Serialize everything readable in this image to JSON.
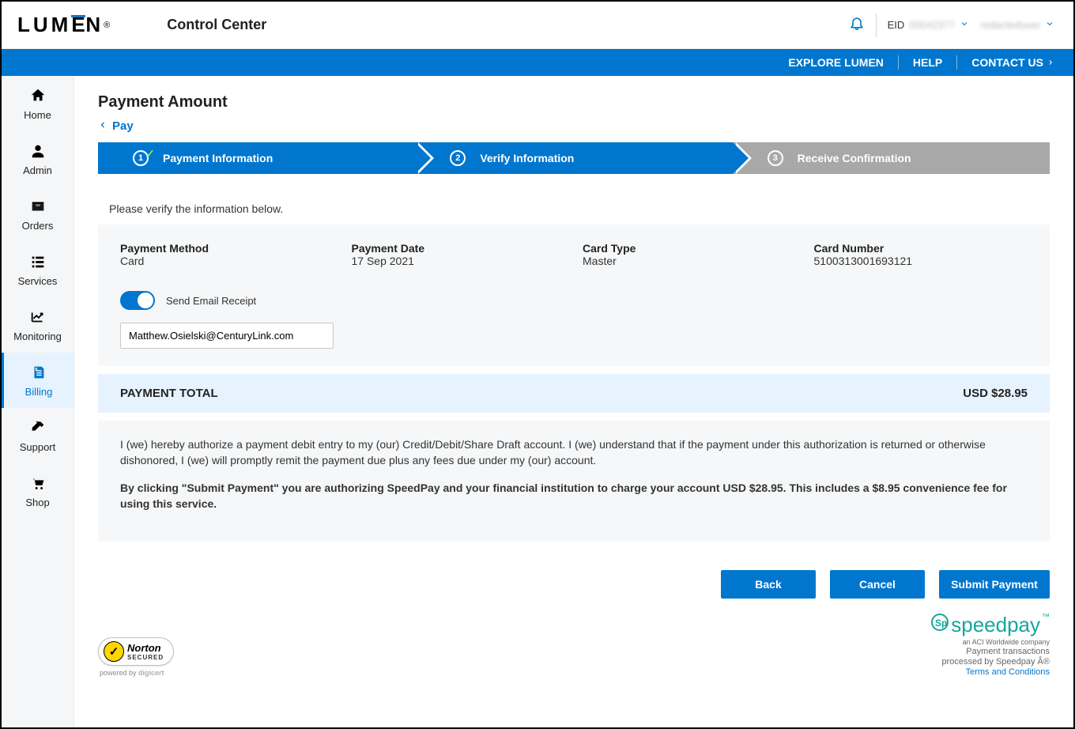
{
  "header": {
    "logo": "LUMEN",
    "app_title": "Control Center",
    "eid_label": "EID",
    "eid_value": "00042377",
    "user_name": "redacteduser"
  },
  "bluebar": {
    "explore": "EXPLORE LUMEN",
    "help": "HELP",
    "contact": "CONTACT US"
  },
  "sidebar": {
    "items": [
      {
        "label": "Home"
      },
      {
        "label": "Admin"
      },
      {
        "label": "Orders"
      },
      {
        "label": "Services"
      },
      {
        "label": "Monitoring"
      },
      {
        "label": "Billing"
      },
      {
        "label": "Support"
      },
      {
        "label": "Shop"
      }
    ]
  },
  "page": {
    "title": "Payment Amount",
    "breadcrumb": "Pay"
  },
  "steps": {
    "s1": "Payment Information",
    "s2": "Verify Information",
    "s3": "Receive Confirmation"
  },
  "verify": {
    "prompt": "Please verify the information below.",
    "pm_label": "Payment Method",
    "pm_value": "Card",
    "pd_label": "Payment Date",
    "pd_value": "17 Sep 2021",
    "ct_label": "Card Type",
    "ct_value": "Master",
    "cn_label": "Card Number",
    "cn_value": "5100313001693121",
    "toggle_label": "Send Email Receipt",
    "email": "Matthew.Osielski@CenturyLink.com"
  },
  "total": {
    "label": "PAYMENT TOTAL",
    "amount": "USD $28.95"
  },
  "auth": {
    "p1": "I (we) hereby authorize a payment debit entry to my (our) Credit/Debit/Share Draft account. I (we) understand that if the payment under this authorization is returned or otherwise dishonored, I (we) will promptly remit the payment due plus any fees due under my (our) account.",
    "p2": "By clicking \"Submit Payment\" you are authorizing SpeedPay and your financial institution to charge your account USD $28.95. This includes a $8.95 convenience fee for using this service."
  },
  "buttons": {
    "back": "Back",
    "cancel": "Cancel",
    "submit": "Submit Payment"
  },
  "footer": {
    "norton_name": "Norton",
    "norton_secured": "SECURED",
    "norton_powered": "powered by ",
    "norton_digicert": "digicert",
    "speedpay_brand": "speedpay",
    "speedpay_sub": "an ACI Worldwide company",
    "line1": "Payment transactions",
    "line2": "processed by Speedpay Â®",
    "terms": "Terms and Conditions"
  }
}
